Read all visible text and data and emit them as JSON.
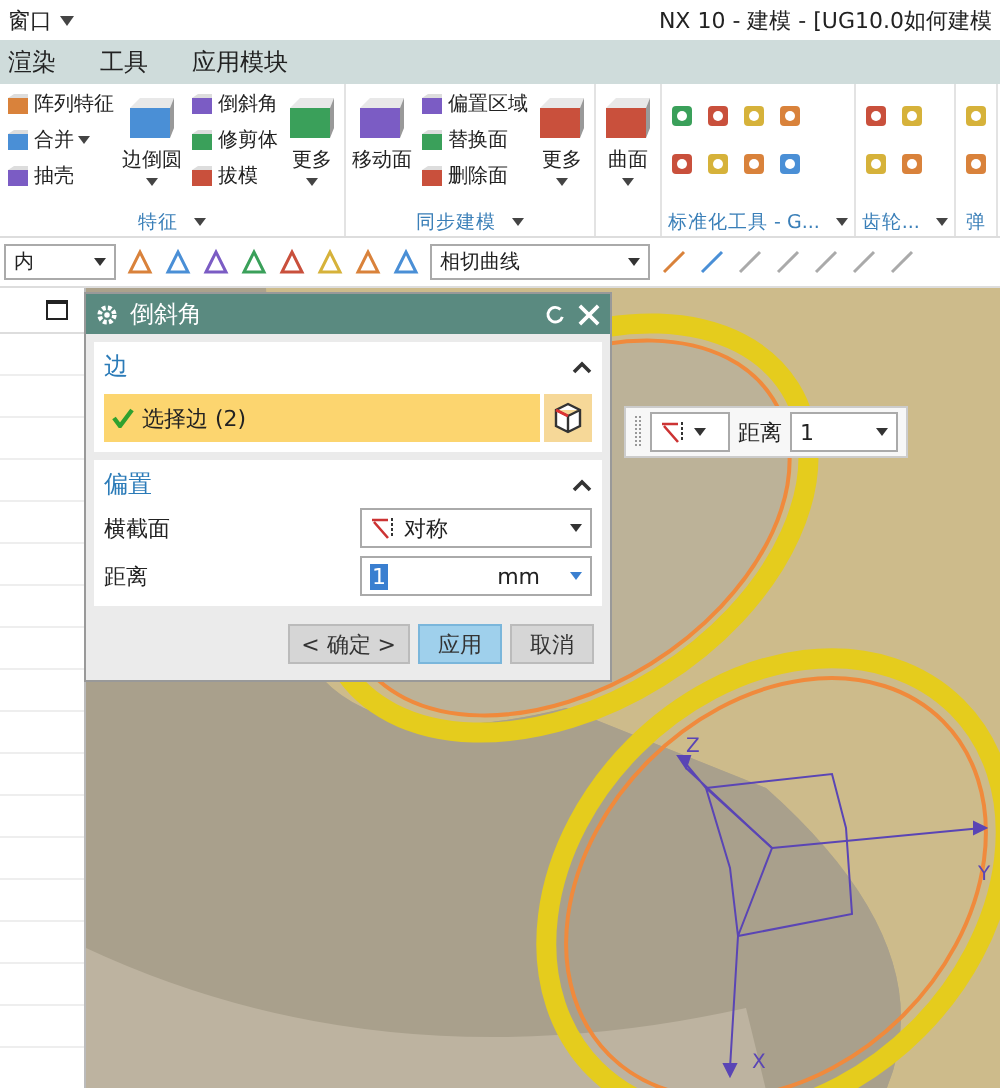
{
  "title_bar": {
    "menu": "窗口",
    "title": "NX 10 - 建模 - [UG10.0如何建模"
  },
  "menu_bar": [
    {
      "label": "渲染"
    },
    {
      "label": "工具"
    },
    {
      "label": "应用模块"
    }
  ],
  "ribbon": [
    {
      "title": "特征",
      "has_menu": true,
      "columns": [
        {
          "kind": "stack",
          "items": [
            {
              "label": "阵列特征",
              "has_menu": false
            },
            {
              "label": "合并",
              "has_menu": true
            },
            {
              "label": "抽壳",
              "has_menu": false
            }
          ]
        },
        {
          "kind": "large",
          "label": "边倒圆",
          "has_menu": true
        },
        {
          "kind": "stack",
          "items": [
            {
              "label": "倒斜角",
              "has_menu": false
            },
            {
              "label": "修剪体",
              "has_menu": false
            },
            {
              "label": "拔模",
              "has_menu": false
            }
          ]
        },
        {
          "kind": "large",
          "label": "更多",
          "has_menu": true
        }
      ]
    },
    {
      "title": "同步建模",
      "has_menu": true,
      "columns": [
        {
          "kind": "large",
          "label": "移动面",
          "has_menu": false
        },
        {
          "kind": "stack",
          "items": [
            {
              "label": "偏置区域",
              "has_menu": false
            },
            {
              "label": "替换面",
              "has_menu": false
            },
            {
              "label": "删除面",
              "has_menu": false
            }
          ]
        },
        {
          "kind": "large",
          "label": "更多",
          "has_menu": true
        }
      ]
    },
    {
      "has_menu": false,
      "columns": [
        {
          "kind": "large",
          "label": "曲面",
          "has_menu": true
        }
      ]
    },
    {
      "title": "标准化工具 - G...",
      "has_menu": true,
      "columns": [
        {
          "kind": "icons4"
        }
      ]
    },
    {
      "title": "齿轮...",
      "has_menu": true,
      "columns": [
        {
          "kind": "icons2"
        }
      ]
    },
    {
      "title": "弹",
      "has_menu": false,
      "columns": [
        {
          "kind": "icons1"
        }
      ]
    }
  ],
  "toolbar": {
    "filter": "内",
    "curve_rule": "相切曲线"
  },
  "dialog": {
    "title": "倒斜角",
    "sections": [
      {
        "title": "边",
        "expanded": true,
        "kind": "selection",
        "label": "选择边 (2)",
        "complete": true,
        "selected": true
      },
      {
        "title": "偏置",
        "expanded": true,
        "kind": "fields",
        "fields": [
          {
            "label": "横截面",
            "kind": "dropdown",
            "value": "对称"
          },
          {
            "label": "距离",
            "kind": "number",
            "value": "1",
            "unit": "mm"
          }
        ]
      }
    ],
    "buttons": [
      {
        "label": "< 确定 >",
        "primary": false
      },
      {
        "label": "应用",
        "primary": true
      },
      {
        "label": "取消",
        "primary": false
      }
    ]
  },
  "float_bar": {
    "label": "距离",
    "value": "1"
  },
  "canvas": {
    "axis_labels": [
      "Z",
      "Y",
      "X"
    ]
  }
}
